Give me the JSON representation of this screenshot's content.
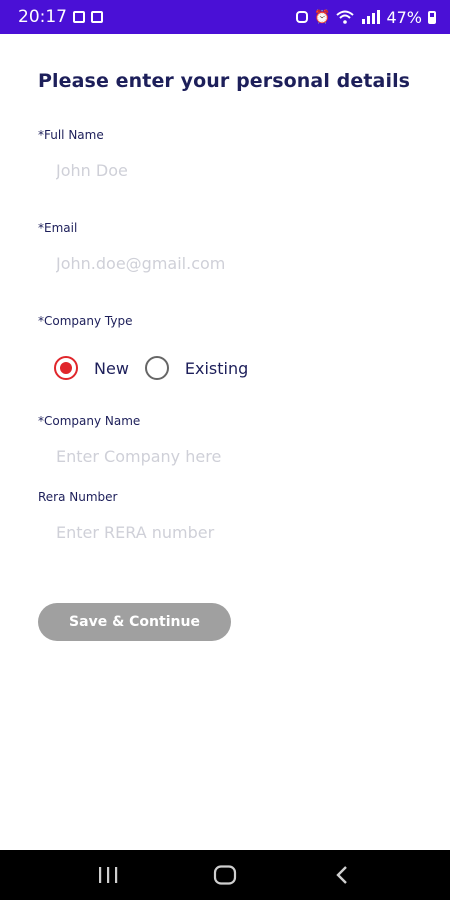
{
  "status_bar": {
    "time": "20:17",
    "battery": "47%",
    "left_icons": [
      "image-icon",
      "app-notification-icon"
    ],
    "right_icons": [
      "lock-notification-icon",
      "alarm-icon",
      "wifi-icon",
      "signal-icon",
      "battery-icon"
    ]
  },
  "form": {
    "title": "Please enter your personal details",
    "full_name": {
      "label": "*Full Name",
      "placeholder": "John Doe",
      "value": ""
    },
    "email": {
      "label": "*Email",
      "placeholder": "John.doe@gmail.com",
      "value": ""
    },
    "company_type": {
      "label": "*Company Type",
      "options": [
        {
          "label": "New",
          "selected": true
        },
        {
          "label": "Existing",
          "selected": false
        }
      ],
      "accent_color": "#e0262b"
    },
    "company_name": {
      "label": "*Company Name",
      "placeholder": "Enter Company here",
      "value": ""
    },
    "rera_number": {
      "label": "Rera Number",
      "placeholder": "Enter RERA number",
      "value": ""
    },
    "save_label": "Save & Continue"
  },
  "nav_bar": {
    "buttons": [
      "recent-apps-icon",
      "home-icon",
      "back-icon"
    ]
  },
  "colors": {
    "status_bar": "#4a10d6",
    "label_text": "#1d1f5a",
    "button_disabled": "#a0a0a0"
  }
}
